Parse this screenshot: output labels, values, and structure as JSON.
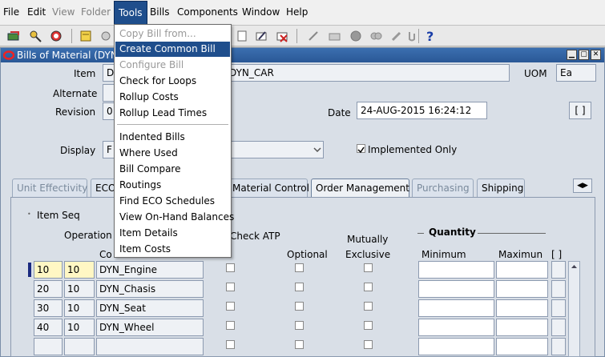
{
  "menubar": {
    "items": [
      {
        "label": "File",
        "disabled": false
      },
      {
        "label": "Edit",
        "disabled": false
      },
      {
        "label": "View",
        "disabled": true
      },
      {
        "label": "Folder",
        "disabled": true
      },
      {
        "label": "Tools",
        "disabled": false
      },
      {
        "label": "Bills",
        "disabled": false
      },
      {
        "label": "Components",
        "disabled": false
      },
      {
        "label": "Window",
        "disabled": false
      },
      {
        "label": "Help",
        "disabled": false
      }
    ]
  },
  "tools_menu": {
    "items": [
      {
        "label": "Copy Bill from...",
        "disabled": true
      },
      {
        "label": "Create Common Bill",
        "highlighted": true
      },
      {
        "label": "Configure Bill",
        "disabled": true
      },
      {
        "label": "Check for Loops"
      },
      {
        "label": "Rollup Costs"
      },
      {
        "label": "Rollup Lead Times"
      },
      {
        "label": "Indented Bills"
      },
      {
        "label": "Where Used"
      },
      {
        "label": "Bill Compare"
      },
      {
        "label": "Routings"
      },
      {
        "label": "Find ECO Schedules"
      },
      {
        "label": "View On-Hand Balances"
      },
      {
        "label": "Item Details"
      },
      {
        "label": "Item Costs"
      }
    ]
  },
  "window": {
    "title": "Bills of Material (DYN)",
    "header": {
      "item_label": "Item",
      "item_value": "D",
      "item_desc": "DYN_CAR",
      "uom_label": "UOM",
      "uom_value": "Ea",
      "alternate_label": "Alternate",
      "revision_label": "Revision",
      "revision_value": "0",
      "date_label": "Date",
      "date_value": "24-AUG-2015 16:24:12",
      "display_label": "Display",
      "display_value": "F",
      "implemented_only_label": "Implemented Only",
      "implemented_only_checked": true,
      "bracket_field": "[ ]"
    },
    "tabs": [
      {
        "label": "Unit Effectivity",
        "state": "disabled"
      },
      {
        "label": "ECO",
        "state": "enabled"
      },
      {
        "label": "Material Control",
        "state": "enabled"
      },
      {
        "label": "Order Management",
        "state": "active"
      },
      {
        "label": "Purchasing",
        "state": "disabled"
      },
      {
        "label": "Shipping",
        "state": "enabled"
      }
    ],
    "grid": {
      "col_item_seq": "Item Seq",
      "col_operation_seq": "Operation S",
      "col_component": "Co",
      "col_check_atp": "Check ATP",
      "col_optional": "Optional",
      "col_mutually_exclusive_1": "Mutually",
      "col_mutually_exclusive_2": "Exclusive",
      "quantity_group": "Quantity",
      "col_minimum": "Minimum",
      "col_maximum": "Maximun",
      "col_bracket": "[ ]",
      "rows": [
        {
          "item_seq": "10",
          "op_seq": "10",
          "component": "DYN_Engine"
        },
        {
          "item_seq": "20",
          "op_seq": "10",
          "component": "DYN_Chasis"
        },
        {
          "item_seq": "30",
          "op_seq": "10",
          "component": "DYN_Seat"
        },
        {
          "item_seq": "40",
          "op_seq": "10",
          "component": "DYN_Wheel"
        },
        {
          "item_seq": "",
          "op_seq": "",
          "component": ""
        }
      ]
    }
  },
  "colors": {
    "accent": "#1f4e8c",
    "titlebar": "#2a5896",
    "current_cell": "#fff7c4"
  }
}
